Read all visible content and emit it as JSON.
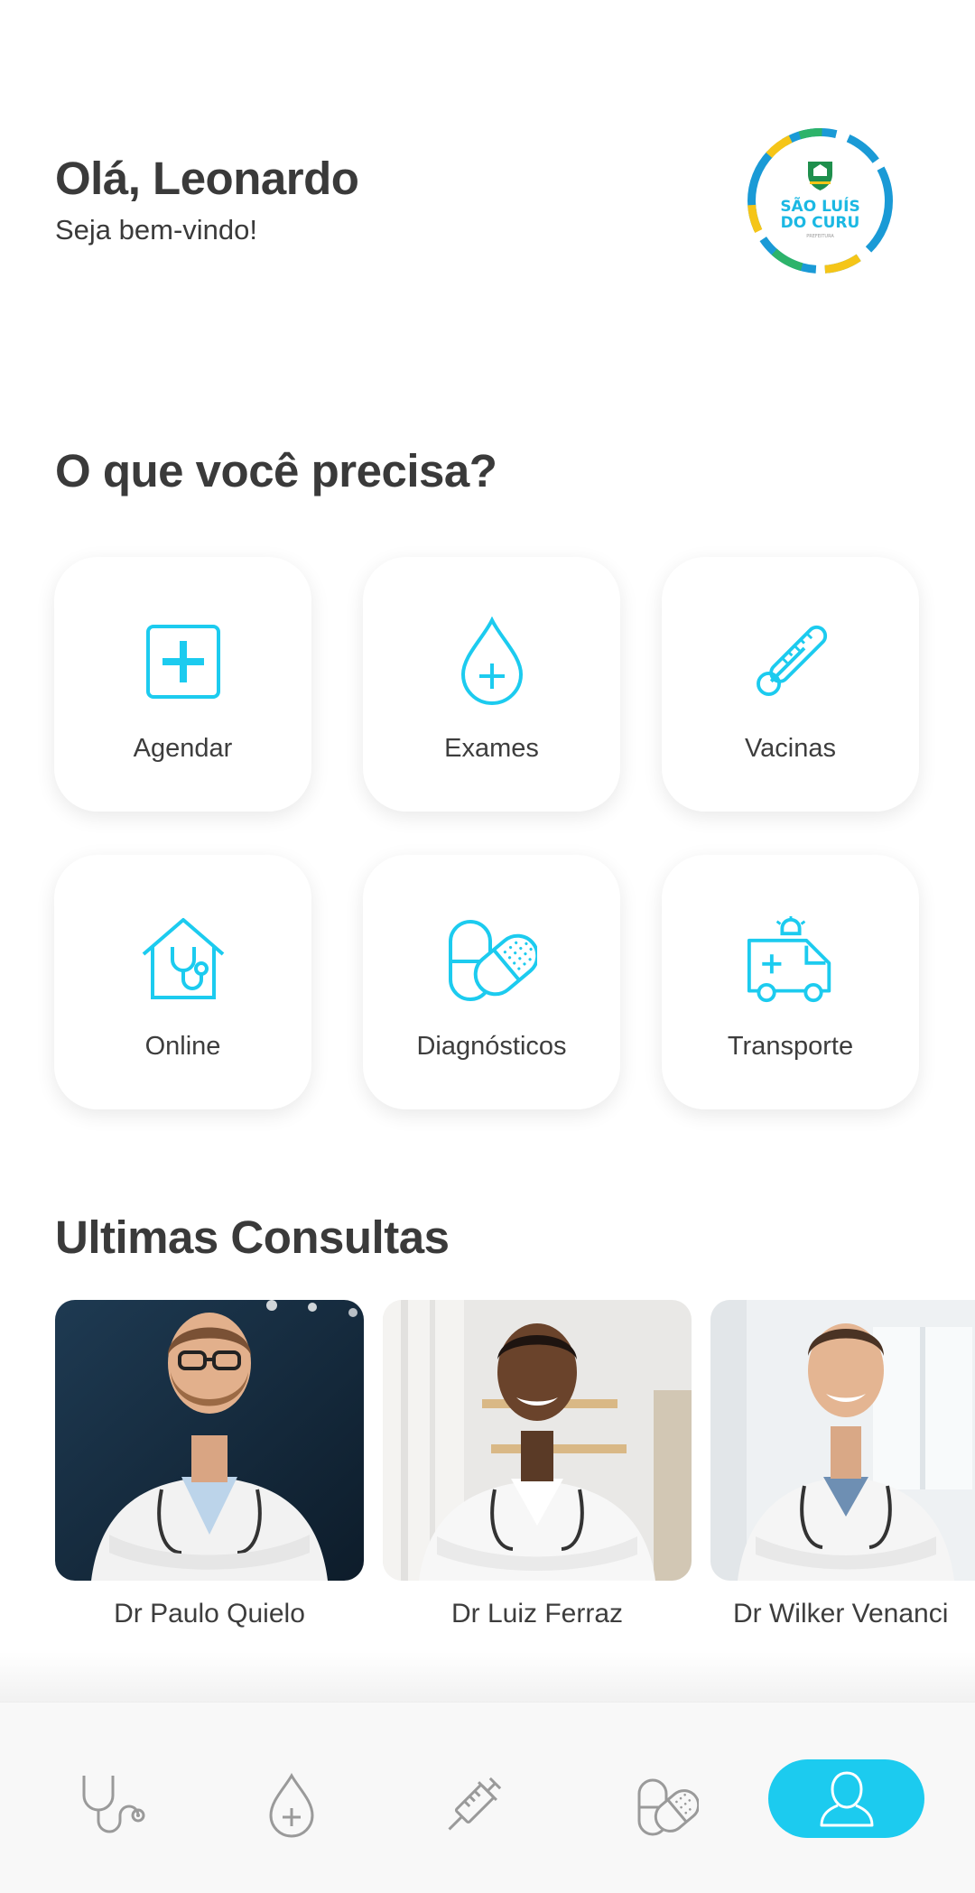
{
  "header": {
    "greeting": "Olá, Leonardo",
    "subtitle": "Seja bem-vindo!",
    "logo": {
      "line1": "SÃO LUÍS",
      "line2": "DO CURU",
      "line3": "PREFEITURA"
    }
  },
  "services": {
    "title": "O que você precisa?",
    "items": [
      {
        "label": "Agendar",
        "icon": "plus-square-icon"
      },
      {
        "label": "Exames",
        "icon": "drop-plus-icon"
      },
      {
        "label": "Vacinas",
        "icon": "thermometer-icon"
      },
      {
        "label": "Online",
        "icon": "house-stethoscope-icon"
      },
      {
        "label": "Diagnósticos",
        "icon": "pills-icon"
      },
      {
        "label": "Transporte",
        "icon": "ambulance-icon"
      }
    ]
  },
  "consultas": {
    "title": "Ultimas Consultas",
    "doctors": [
      {
        "name": "Dr Paulo Quielo"
      },
      {
        "name": "Dr Luiz Ferraz"
      },
      {
        "name": "Dr Wilker Venanci"
      }
    ]
  },
  "bottom_nav": {
    "items": [
      "stethoscope-icon",
      "drop-plus-icon",
      "syringe-icon",
      "pills-icon",
      "user-icon"
    ],
    "active": "user-icon"
  },
  "colors": {
    "accent": "#1ccbef",
    "text": "#3a3a3a",
    "nav_icon": "#9a9a9a"
  }
}
